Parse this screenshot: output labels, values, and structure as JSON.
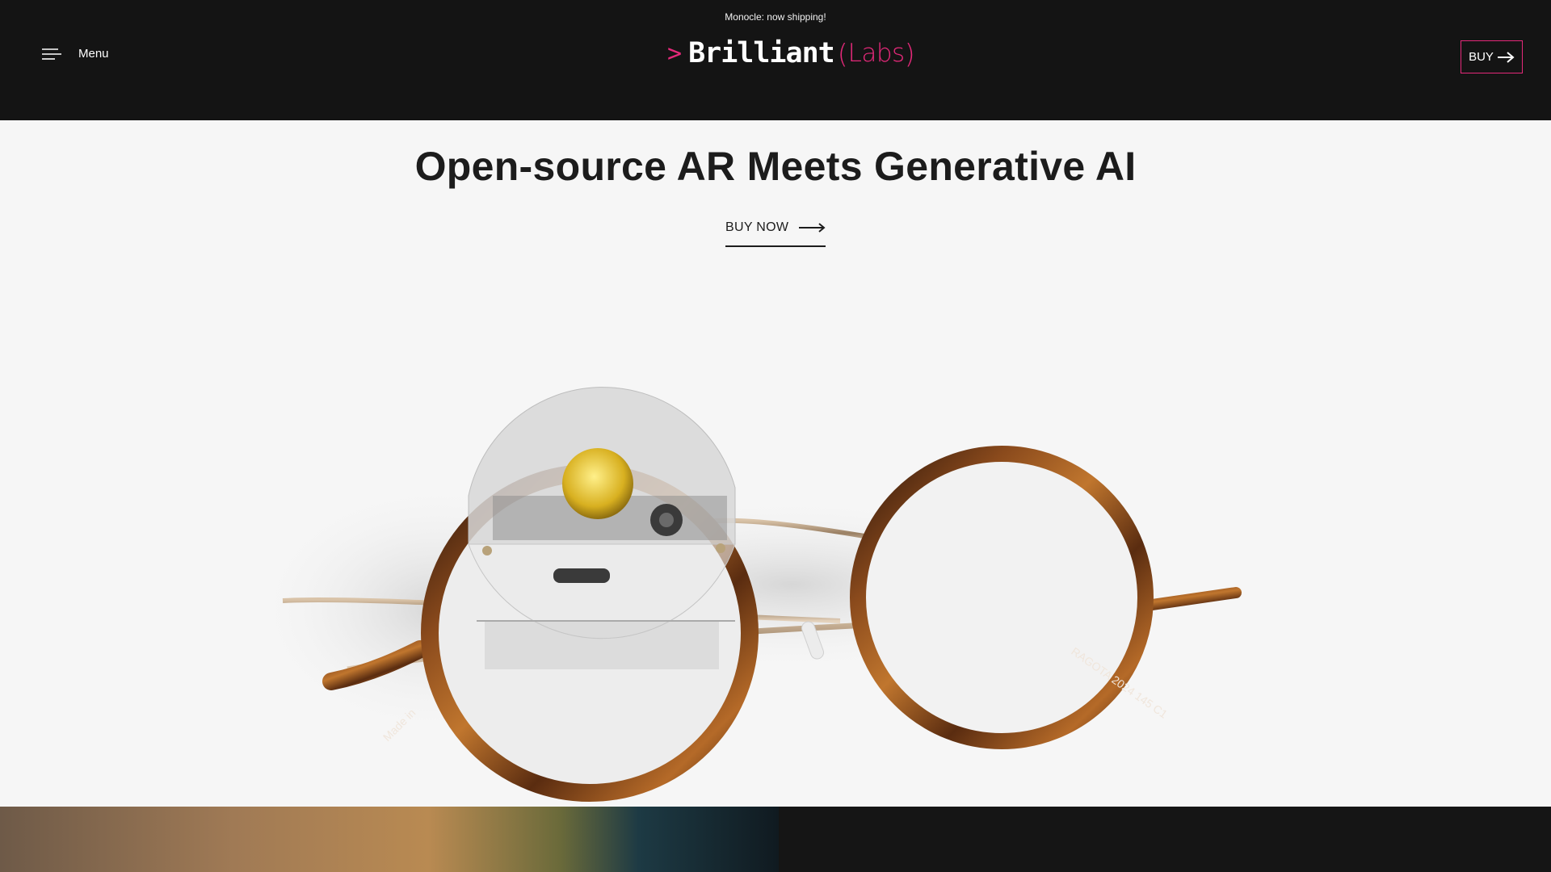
{
  "announcement": "Monocle: now shipping!",
  "nav": {
    "menu_label": "Menu",
    "menu_icon": "hamburger-icon",
    "logo": {
      "chevron": ">",
      "main": "Brilliant",
      "paren_open": "(",
      "labs": "Labs",
      "paren_close": ")"
    },
    "buy_label": "BUY",
    "buy_icon": "arrow-right-icon"
  },
  "hero": {
    "title": "Open-source AR Meets Generative AI",
    "cta_label": "BUY NOW",
    "cta_icon": "long-arrow-right-icon",
    "image": "Round tortoiseshell glasses with Monocle AR device clipped on left lens"
  },
  "colors": {
    "accent": "#e5297a",
    "header_bg": "#141414",
    "hero_bg": "#f6f6f6",
    "text_dark": "#1c1c1c"
  }
}
